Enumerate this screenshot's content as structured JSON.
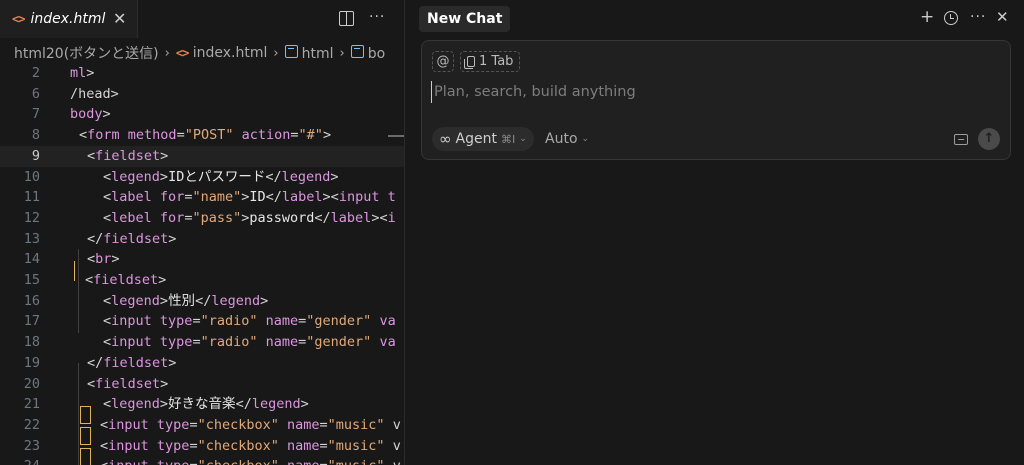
{
  "editor": {
    "tab": {
      "icon": "html-file-icon",
      "title": "index.html"
    },
    "breadcrumb": [
      {
        "label": "html20(ボタンと送信)",
        "icon": ""
      },
      {
        "label": "index.html",
        "icon": "html-file-icon"
      },
      {
        "label": "html",
        "icon": "symbol-cube-icon"
      },
      {
        "label": "bo",
        "icon": "symbol-cube-icon"
      }
    ],
    "active_line": "9",
    "lines": [
      {
        "n": "2",
        "tokens": [
          [
            "t",
            "ml"
          ],
          [
            "p",
            ">"
          ]
        ]
      },
      {
        "n": "6",
        "tokens": [
          [
            "p",
            "/head>"
          ]
        ]
      },
      {
        "n": "7",
        "tokens": [
          [
            "t",
            "body"
          ],
          [
            "p",
            ">"
          ]
        ]
      },
      {
        "n": "8",
        "tokens": [
          [
            "p",
            "<"
          ],
          [
            "t",
            "form "
          ],
          [
            "a",
            "method"
          ],
          [
            "p",
            "="
          ],
          [
            "s",
            "\"POST\""
          ],
          [
            "p",
            " "
          ],
          [
            "a",
            "action"
          ],
          [
            "p",
            "="
          ],
          [
            "s",
            "\"#\""
          ],
          [
            "p",
            ">"
          ]
        ]
      },
      {
        "n": "9",
        "tokens": [
          [
            "p",
            "<"
          ],
          [
            "t",
            "fieldset"
          ],
          [
            "p",
            ">"
          ]
        ]
      },
      {
        "n": "10",
        "tokens": [
          [
            "p",
            "<"
          ],
          [
            "t",
            "legend"
          ],
          [
            "p",
            ">"
          ],
          [
            "x",
            "IDとパスワード"
          ],
          [
            "p",
            "</"
          ],
          [
            "t",
            "legend"
          ],
          [
            "p",
            ">"
          ]
        ]
      },
      {
        "n": "11",
        "tokens": [
          [
            "p",
            "<"
          ],
          [
            "t",
            "label "
          ],
          [
            "a",
            "for"
          ],
          [
            "p",
            "="
          ],
          [
            "s",
            "\"name\""
          ],
          [
            "p",
            ">"
          ],
          [
            "x",
            "ID"
          ],
          [
            "p",
            "</"
          ],
          [
            "t",
            "label"
          ],
          [
            "p",
            "><"
          ],
          [
            "t",
            "input t"
          ]
        ]
      },
      {
        "n": "12",
        "tokens": [
          [
            "p",
            "<"
          ],
          [
            "t",
            "lebel "
          ],
          [
            "a",
            "for"
          ],
          [
            "p",
            "="
          ],
          [
            "s",
            "\"pass\""
          ],
          [
            "p",
            ">"
          ],
          [
            "x",
            "password"
          ],
          [
            "p",
            "</"
          ],
          [
            "t",
            "label"
          ],
          [
            "p",
            "><"
          ],
          [
            "t",
            "i"
          ]
        ]
      },
      {
        "n": "13",
        "tokens": [
          [
            "p",
            "</"
          ],
          [
            "t",
            "fieldset"
          ],
          [
            "p",
            ">"
          ]
        ]
      },
      {
        "n": "14",
        "tokens": [
          [
            "p",
            "<"
          ],
          [
            "t",
            "br"
          ],
          [
            "p",
            ">"
          ]
        ]
      },
      {
        "n": "15",
        "tokens": [
          [
            "p",
            "<"
          ],
          [
            "t",
            "fieldset"
          ],
          [
            "p",
            ">"
          ]
        ]
      },
      {
        "n": "16",
        "tokens": [
          [
            "p",
            "<"
          ],
          [
            "t",
            "legend"
          ],
          [
            "p",
            ">"
          ],
          [
            "x",
            "性別"
          ],
          [
            "p",
            "</"
          ],
          [
            "t",
            "legend"
          ],
          [
            "p",
            ">"
          ]
        ]
      },
      {
        "n": "17",
        "tokens": [
          [
            "p",
            "<"
          ],
          [
            "t",
            "input "
          ],
          [
            "a",
            "type"
          ],
          [
            "p",
            "="
          ],
          [
            "s",
            "\"radio\""
          ],
          [
            "p",
            " "
          ],
          [
            "a",
            "name"
          ],
          [
            "p",
            "="
          ],
          [
            "s",
            "\"gender\""
          ],
          [
            "p",
            " "
          ],
          [
            "a",
            "va"
          ]
        ]
      },
      {
        "n": "18",
        "tokens": [
          [
            "p",
            "<"
          ],
          [
            "t",
            "input "
          ],
          [
            "a",
            "type"
          ],
          [
            "p",
            "="
          ],
          [
            "s",
            "\"radio\""
          ],
          [
            "p",
            " "
          ],
          [
            "a",
            "name"
          ],
          [
            "p",
            "="
          ],
          [
            "s",
            "\"gender\""
          ],
          [
            "p",
            " "
          ],
          [
            "a",
            "va"
          ]
        ]
      },
      {
        "n": "19",
        "tokens": [
          [
            "p",
            "</"
          ],
          [
            "t",
            "fieldset"
          ],
          [
            "p",
            ">"
          ]
        ]
      },
      {
        "n": "20",
        "tokens": [
          [
            "p",
            "<"
          ],
          [
            "t",
            "fieldset"
          ],
          [
            "p",
            ">"
          ]
        ]
      },
      {
        "n": "21",
        "tokens": [
          [
            "p",
            "<"
          ],
          [
            "t",
            "legend"
          ],
          [
            "p",
            ">"
          ],
          [
            "x",
            "好きな音楽"
          ],
          [
            "p",
            "</"
          ],
          [
            "t",
            "legend"
          ],
          [
            "p",
            ">"
          ]
        ]
      },
      {
        "n": "22",
        "tokens": [
          [
            "p",
            "<"
          ],
          [
            "t",
            "input "
          ],
          [
            "a",
            "type"
          ],
          [
            "p",
            "="
          ],
          [
            "s",
            "\"checkbox\""
          ],
          [
            "p",
            " "
          ],
          [
            "a",
            "name"
          ],
          [
            "p",
            "="
          ],
          [
            "s",
            "\"music\""
          ],
          [
            "p",
            " v"
          ]
        ]
      },
      {
        "n": "23",
        "tokens": [
          [
            "p",
            "<"
          ],
          [
            "t",
            "input "
          ],
          [
            "a",
            "type"
          ],
          [
            "p",
            "="
          ],
          [
            "s",
            "\"checkbox\""
          ],
          [
            "p",
            " "
          ],
          [
            "a",
            "name"
          ],
          [
            "p",
            "="
          ],
          [
            "s",
            "\"music\""
          ],
          [
            "p",
            " v"
          ]
        ]
      },
      {
        "n": "24",
        "tokens": [
          [
            "p",
            "<"
          ],
          [
            "t",
            "input "
          ],
          [
            "a",
            "type"
          ],
          [
            "p",
            "="
          ],
          [
            "s",
            "\"checkbox\""
          ],
          [
            "p",
            " "
          ],
          [
            "a",
            "name"
          ],
          [
            "p",
            "="
          ],
          [
            "s",
            "\"music\""
          ],
          [
            "p",
            " v"
          ]
        ]
      }
    ]
  },
  "chat": {
    "tab_label": "New Chat",
    "actions": [
      "plus-icon",
      "history-icon",
      "more-icon",
      "close-icon"
    ],
    "context_at": "@",
    "context_tab": "1 Tab",
    "input_placeholder": "Plan, search, build anything",
    "mode_label": "Agent",
    "mode_shortcut": "⌘I",
    "model_label": "Auto"
  },
  "colors": {
    "background": "#181818",
    "tag": "#dc95df",
    "string": "#e0a97a",
    "bracket_highlight": "#e2b25b",
    "html_icon": "#e8834d",
    "symbol_icon": "#75beff"
  }
}
